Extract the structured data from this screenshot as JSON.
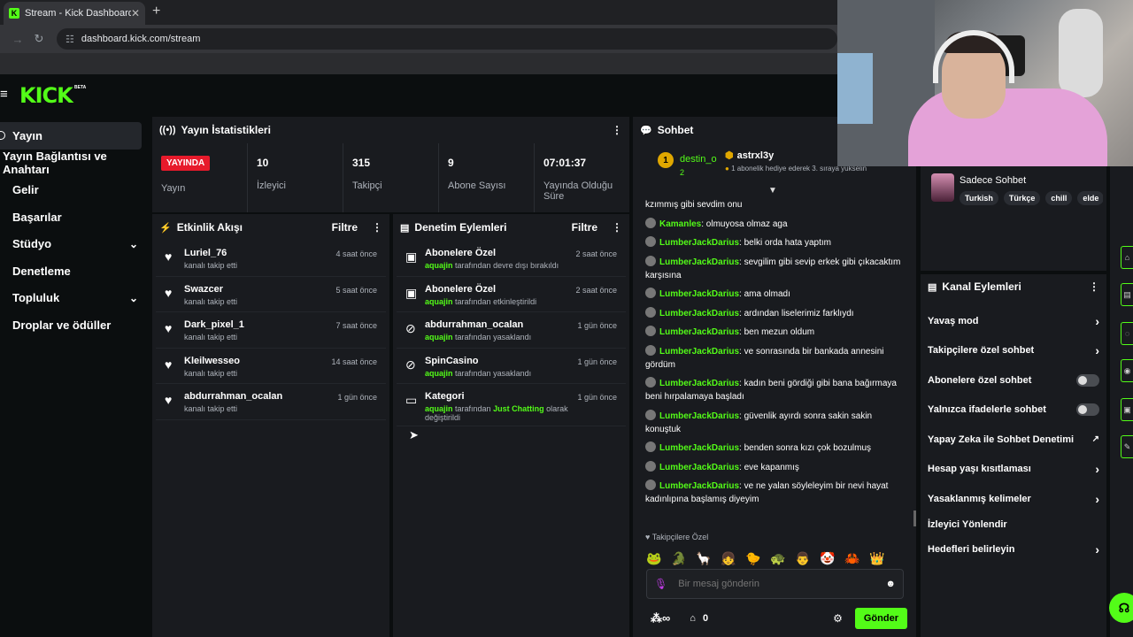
{
  "browser": {
    "tab_title": "Stream - Kick Dashboard",
    "tab_close": "✕",
    "new_tab": "+",
    "url": "dashboard.kick.com/stream"
  },
  "header": {
    "logo": "KICK",
    "beta": "BETA"
  },
  "sidebar": {
    "items": [
      {
        "label": "Yayın"
      },
      {
        "label": "Yayın Bağlantısı ve Anahtarı"
      },
      {
        "label": "Gelir"
      },
      {
        "label": "Başarılar"
      },
      {
        "label": "Stüdyo"
      },
      {
        "label": "Denetleme"
      },
      {
        "label": "Topluluk"
      },
      {
        "label": "Droplar ve ödüller"
      }
    ]
  },
  "stats": {
    "title": "Yayın İstatistikleri",
    "live_badge": "YAYINDA",
    "live_label": "Yayın",
    "items": [
      {
        "value": "10",
        "label": "İzleyici"
      },
      {
        "value": "315",
        "label": "Takipçi"
      },
      {
        "value": "9",
        "label": "Abone Sayısı"
      },
      {
        "value": "07:01:37",
        "label": "Yayında Olduğu Süre"
      }
    ]
  },
  "activity": {
    "title": "Etkinlik Akışı",
    "filter": "Filtre",
    "items": [
      {
        "name": "Luriel_76",
        "sub": "kanalı takip etti",
        "time": "4 saat önce"
      },
      {
        "name": "Swazcer",
        "sub": "kanalı takip etti",
        "time": "5 saat önce"
      },
      {
        "name": "Dark_pixel_1",
        "sub": "kanalı takip etti",
        "time": "7 saat önce"
      },
      {
        "name": "Kleilwesseo",
        "sub": "kanalı takip etti",
        "time": "14 saat önce"
      },
      {
        "name": "abdurrahman_ocalan",
        "sub": "kanalı takip etti",
        "time": "1 gün önce"
      }
    ]
  },
  "moderation": {
    "title": "Denetim Eylemleri",
    "filter": "Filtre",
    "items": [
      {
        "name": "Abonelere Özel",
        "actor": "aquajin",
        "sub": "tarafından devre dışı bırakıldı",
        "time": "2 saat önce"
      },
      {
        "name": "Abonelere Özel",
        "actor": "aquajin",
        "sub": "tarafından etkinleştirildi",
        "time": "2 saat önce"
      },
      {
        "name": "abdurrahman_ocalan",
        "actor": "aquajin",
        "sub": "tarafından yasaklandı",
        "time": "1 gün önce"
      },
      {
        "name": "SpinCasino",
        "actor": "aquajin",
        "sub": "tarafından yasaklandı",
        "time": "1 gün önce"
      },
      {
        "name": "Kategori",
        "actor": "aquajin",
        "sub": "tarafından",
        "category": "Just Chatting",
        "sub2": "olarak değiştirildi",
        "time": "1 gün önce"
      }
    ]
  },
  "chat": {
    "title": "Sohbet",
    "pinned_rank": "1",
    "pinned_user": "destin_o",
    "pinned_count": "2",
    "gifter_user": "astrxl3y",
    "gifter_text": "1 abonelik hediye ederek 3. sıraya yükselin",
    "messages": [
      {
        "user": "",
        "text": "kzımmış gibi sevdim onu"
      },
      {
        "user": "Kamanles",
        "text": ": olmuyosa olmaz aga"
      },
      {
        "user": "LumberJackDarius",
        "text": ": belki orda hata yaptım"
      },
      {
        "user": "LumberJackDarius",
        "text": ": sevgilim gibi sevip erkek gibi çıkacaktım karşısına"
      },
      {
        "user": "LumberJackDarius",
        "text": ": ama olmadı"
      },
      {
        "user": "LumberJackDarius",
        "text": ": ardından liselerimiz farklıydı"
      },
      {
        "user": "LumberJackDarius",
        "text": ": ben mezun oldum"
      },
      {
        "user": "LumberJackDarius",
        "text": ": ve sonrasında bir bankada annesini gördüm"
      },
      {
        "user": "LumberJackDarius",
        "text": ": kadın beni gördiği gibi bana bağırmaya beni hırpalamaya başladı"
      },
      {
        "user": "LumberJackDarius",
        "text": ": güvenlik ayırdı sonra sakin sakin konuştuk"
      },
      {
        "user": "LumberJackDarius",
        "text": ": benden sonra kızı çok bozulmuş"
      },
      {
        "user": "LumberJackDarius",
        "text": ": eve kapanmış"
      },
      {
        "user": "LumberJackDarius",
        "text": ": ve ne yalan söyleleyim bir nevi hayat kadınlıpına başlamış diyeyim"
      }
    ],
    "follow_only": "Takipçilere Özel",
    "input_placeholder": "Bir mesaj gönderin",
    "points": "0",
    "send": "Gönder"
  },
  "stream_info": {
    "title": "Sadece Sohbet",
    "tags": [
      "Turkish",
      "Türkçe",
      "chill",
      "elde"
    ]
  },
  "channel_actions": {
    "title": "Kanal Eylemleri",
    "items": [
      {
        "label": "Yavaş mod",
        "type": "arrow"
      },
      {
        "label": "Takipçilere özel sohbet",
        "type": "arrow"
      },
      {
        "label": "Abonelere özel sohbet",
        "type": "toggle"
      },
      {
        "label": "Yalnızca ifadelerle sohbet",
        "type": "toggle"
      },
      {
        "label": "Yapay Zeka ile Sohbet Denetimi",
        "type": "external"
      },
      {
        "label": "Hesap yaşı kısıtlaması",
        "type": "arrow"
      },
      {
        "label": "Yasaklanmış kelimeler",
        "type": "arrow"
      },
      {
        "label": "İzleyici Yönlendir",
        "type": "none"
      },
      {
        "label": "Hedefleri belirleyin",
        "type": "arrow"
      }
    ]
  },
  "colors": {
    "accent": "#53fc18",
    "live": "#e71a2b",
    "panel": "#191b1f",
    "background": "#0b0e0f"
  }
}
